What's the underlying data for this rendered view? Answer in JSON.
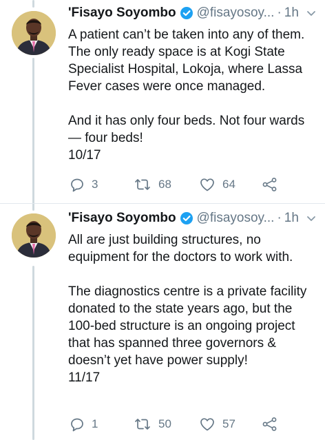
{
  "colors": {
    "text": "#14171a",
    "secondary": "#657786",
    "verified": "#1da1f2",
    "thread_line": "#cfd9de",
    "avatar_bg": "#d9c27c"
  },
  "tweets": [
    {
      "author_name": "'Fisayo Soyombo",
      "handle": "@fisayosoy...",
      "separator": "·",
      "time": "1h",
      "paragraphs": [
        "A patient can’t be taken into any of them. The only ready space is at Kogi State Specialist Hospital, Lokoja, where Lassa Fever cases were once managed.",
        "And it has only four beds. Not four wards — four beds!\n10/17"
      ],
      "replies": "3",
      "retweets": "68",
      "likes": "64"
    },
    {
      "author_name": "'Fisayo Soyombo",
      "handle": "@fisayosoy...",
      "separator": "·",
      "time": "1h",
      "paragraphs": [
        "All are just building structures, no equipment for the doctors to work with.",
        "The diagnostics centre is a private facility donated to the state years ago, but the 100-bed structure is an ongoing project that has spanned three governors & doesn’t yet have power supply!\n11/17"
      ],
      "replies": "1",
      "retweets": "50",
      "likes": "57"
    }
  ],
  "icons": {
    "verified": "verified-badge-icon",
    "caret": "chevron-down-icon",
    "reply": "reply-icon",
    "retweet": "retweet-icon",
    "like": "heart-icon",
    "share": "share-icon"
  }
}
